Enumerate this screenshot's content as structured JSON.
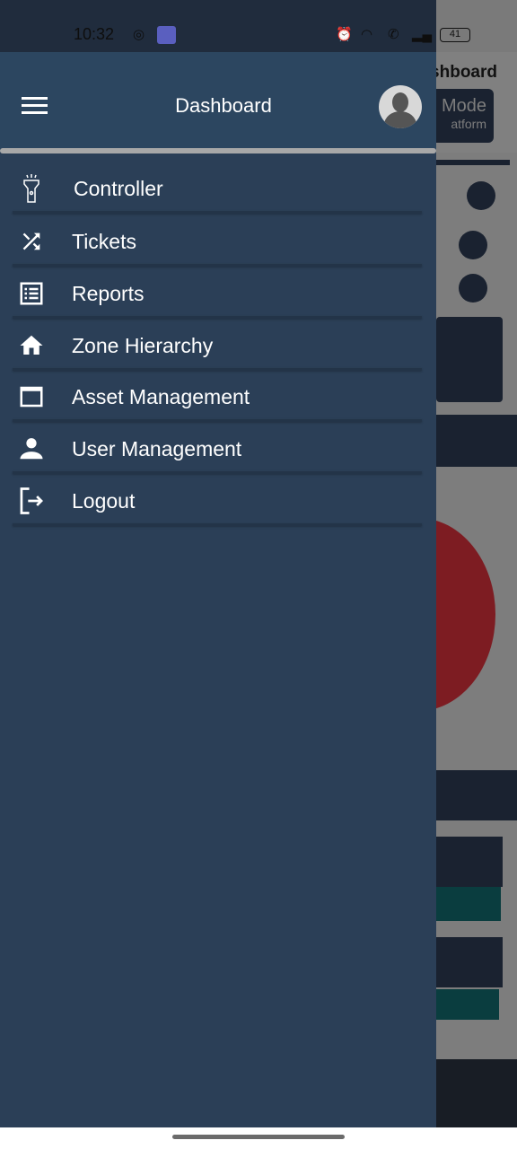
{
  "status_bar": {
    "time": "10:32",
    "battery": "41",
    "icons": [
      "whatsapp-icon",
      "android-icon",
      "alarm-icon",
      "wifi-icon",
      "wifi-call-icon",
      "signal-icon",
      "battery-icon"
    ]
  },
  "background": {
    "title_partial": "shboard",
    "mode_label_partial": "Mode",
    "mode_sub_partial": "atform",
    "pie_color": "#7d1c22"
  },
  "drawer": {
    "header": {
      "title": "Dashboard"
    },
    "items": [
      {
        "label": "Controller",
        "icon": "flashlight-icon"
      },
      {
        "label": "Tickets",
        "icon": "shuffle-icon"
      },
      {
        "label": "Reports",
        "icon": "list-icon"
      },
      {
        "label": "Zone Hierarchy",
        "icon": "home-icon"
      },
      {
        "label": "Asset Management",
        "icon": "window-icon"
      },
      {
        "label": "User Management",
        "icon": "person-icon"
      },
      {
        "label": "Logout",
        "icon": "logout-icon"
      }
    ],
    "colors": {
      "background": "#2b3f57",
      "header": "#2c4660"
    }
  }
}
